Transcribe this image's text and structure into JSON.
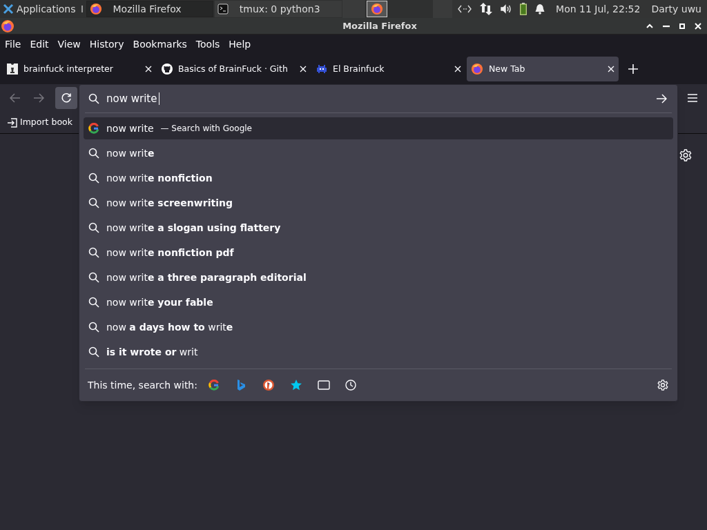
{
  "panel": {
    "apps_label": "Applications",
    "tasks": [
      {
        "label": "Mozilla Firefox",
        "selected": true
      },
      {
        "label": "tmux: 0 python3",
        "selected": false
      }
    ],
    "clock": "Mon 11 Jul, 22:52",
    "user": "Darty uwu"
  },
  "window": {
    "title": "Mozilla Firefox"
  },
  "menu": [
    "File",
    "Edit",
    "View",
    "History",
    "Bookmarks",
    "Tools",
    "Help"
  ],
  "tabs": [
    {
      "label": "brainfuck interpreter",
      "selected": false
    },
    {
      "label": "Basics of BrainFuck · Gith",
      "selected": false
    },
    {
      "label": "El Brainfuck",
      "selected": false
    },
    {
      "label": "New Tab",
      "selected": true
    }
  ],
  "bookmarks_bar": {
    "import_label": "Import book"
  },
  "urlbar": {
    "value": "now write"
  },
  "suggestions": [
    {
      "kind": "engine",
      "text": "now write",
      "action": "— Search with Google",
      "selected": true
    },
    {
      "kind": "search",
      "text": "now writ**e**",
      "selected": false
    },
    {
      "kind": "search",
      "text": "now writ**e nonfiction**",
      "selected": false
    },
    {
      "kind": "search",
      "text": "now writ**e screenwriting**",
      "selected": false
    },
    {
      "kind": "search",
      "text": "now writ**e a slogan using flattery**",
      "selected": false
    },
    {
      "kind": "search",
      "text": "now writ**e nonfiction pdf**",
      "selected": false
    },
    {
      "kind": "search",
      "text": "now writ**e a three paragraph editorial**",
      "selected": false
    },
    {
      "kind": "search",
      "text": "now writ**e your fable**",
      "selected": false
    },
    {
      "kind": "search",
      "text": "now **a days how to** writ**e**",
      "selected": false
    },
    {
      "kind": "search",
      "text": "**is it wrote or** writ",
      "selected": false
    }
  ],
  "one_off": {
    "label": "This time, search with:"
  }
}
